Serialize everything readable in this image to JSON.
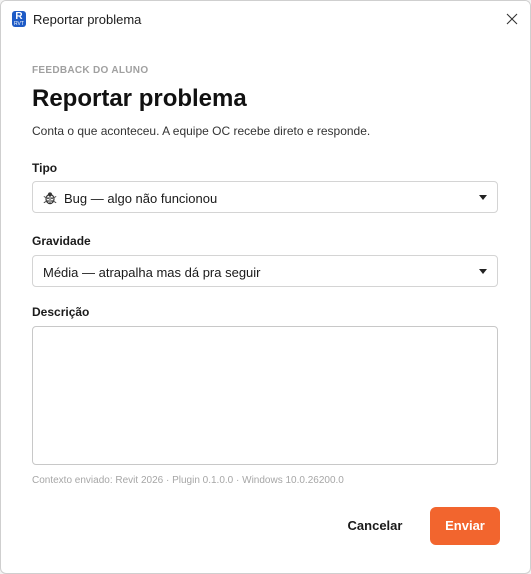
{
  "window": {
    "title": "Reportar problema",
    "app_icon_letter": "R",
    "app_icon_sub": "RVT"
  },
  "form": {
    "eyebrow": "FEEDBACK DO ALUNO",
    "heading": "Reportar problema",
    "subtitle": "Conta o que aconteceu. A equipe OC recebe direto e responde.",
    "type": {
      "label": "Tipo",
      "selected": "Bug — algo não funcionou",
      "icon": "bug-icon"
    },
    "severity": {
      "label": "Gravidade",
      "selected": "Média — atrapalha mas dá pra seguir"
    },
    "description": {
      "label": "Descrição",
      "value": ""
    },
    "context": "Contexto enviado: Revit 2026 · Plugin 0.1.0.0 · Windows 10.0.26200.0"
  },
  "actions": {
    "cancel_label": "Cancelar",
    "send_label": "Enviar"
  },
  "colors": {
    "accent": "#f2652e",
    "app_icon": "#1e5bc6"
  }
}
